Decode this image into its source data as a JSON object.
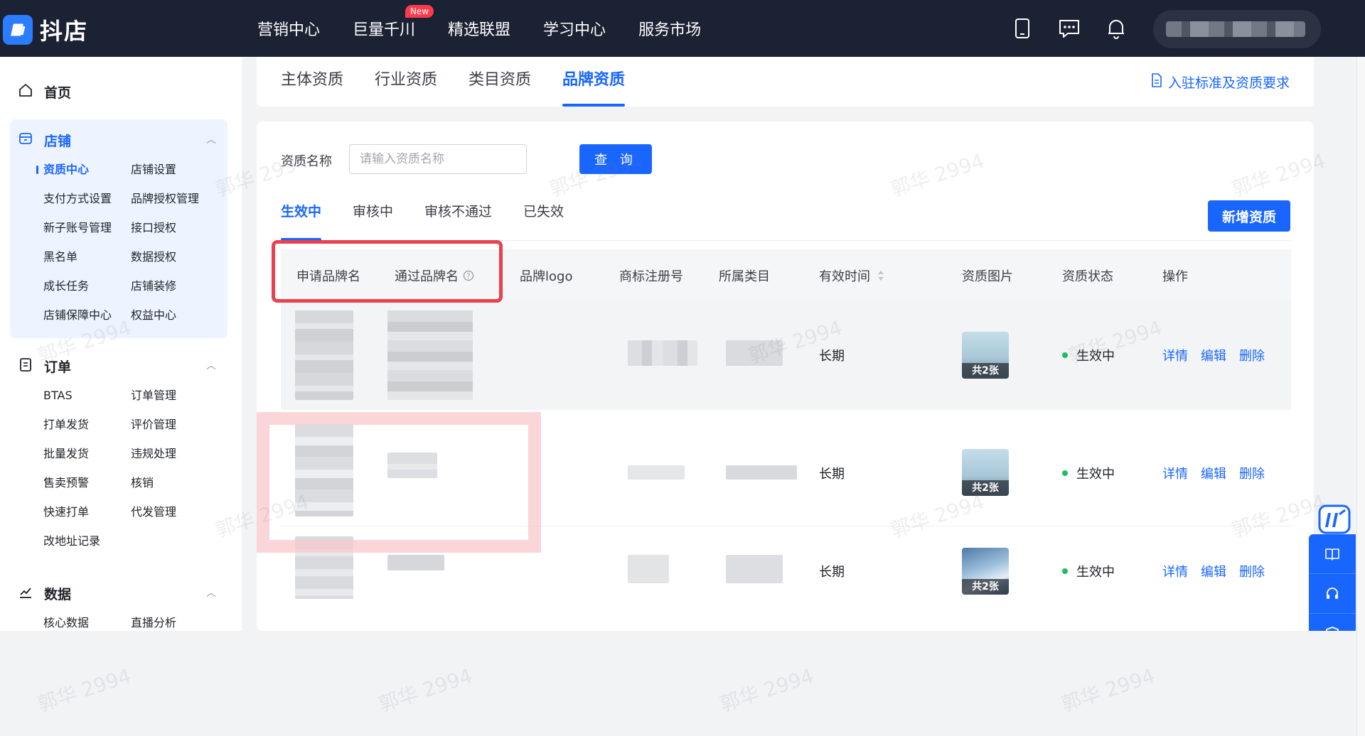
{
  "app": {
    "logo_text": "抖店"
  },
  "topnav": {
    "items": [
      "营销中心",
      "巨量千川",
      "精选联盟",
      "学习中心",
      "服务市场"
    ],
    "new_badge": "New"
  },
  "sidebar": {
    "home": "首页",
    "shop": {
      "title": "店铺",
      "items": [
        "资质中心",
        "店铺设置",
        "支付方式设置",
        "品牌授权管理",
        "新子账号管理",
        "接口授权",
        "黑名单",
        "数据授权",
        "成长任务",
        "店铺装修",
        "店铺保障中心",
        "权益中心"
      ]
    },
    "order": {
      "title": "订单",
      "items": [
        "BTAS",
        "订单管理",
        "打单发货",
        "评价管理",
        "批量发货",
        "违规处理",
        "售卖预警",
        "核销",
        "快速打单",
        "代发管理",
        "改地址记录"
      ]
    },
    "data": {
      "title": "数据",
      "items": [
        "核心数据",
        "直播分析"
      ]
    }
  },
  "qual_tabs": [
    "主体资质",
    "行业资质",
    "类目资质",
    "品牌资质"
  ],
  "req_link": "入驻标准及资质要求",
  "search": {
    "label": "资质名称",
    "placeholder": "请输入资质名称",
    "button": "查 询"
  },
  "status_tabs": [
    "生效中",
    "审核中",
    "审核不通过",
    "已失效"
  ],
  "add_button": "新增资质",
  "table": {
    "headers": [
      "申请品牌名",
      "通过品牌名",
      "品牌logo",
      "商标注册号",
      "所属类目",
      "有效时间",
      "资质图片",
      "资质状态",
      "操作"
    ],
    "rows": [
      {
        "valid_time": "长期",
        "image_label": "共2张",
        "status": "生效中",
        "actions": [
          "详情",
          "编辑",
          "删除"
        ]
      },
      {
        "valid_time": "长期",
        "image_label": "共2张",
        "status": "生效中",
        "actions": [
          "详情",
          "编辑",
          "删除"
        ]
      },
      {
        "valid_time": "长期",
        "image_label": "共2张",
        "status": "生效中",
        "actions": [
          "详情",
          "编辑",
          "删除"
        ]
      }
    ]
  },
  "watermark": "郭华 2994",
  "colors": {
    "primary": "#1966ff",
    "topbar": "#1b2233",
    "success": "#1bbf5b",
    "highlight": "#e8414f"
  }
}
